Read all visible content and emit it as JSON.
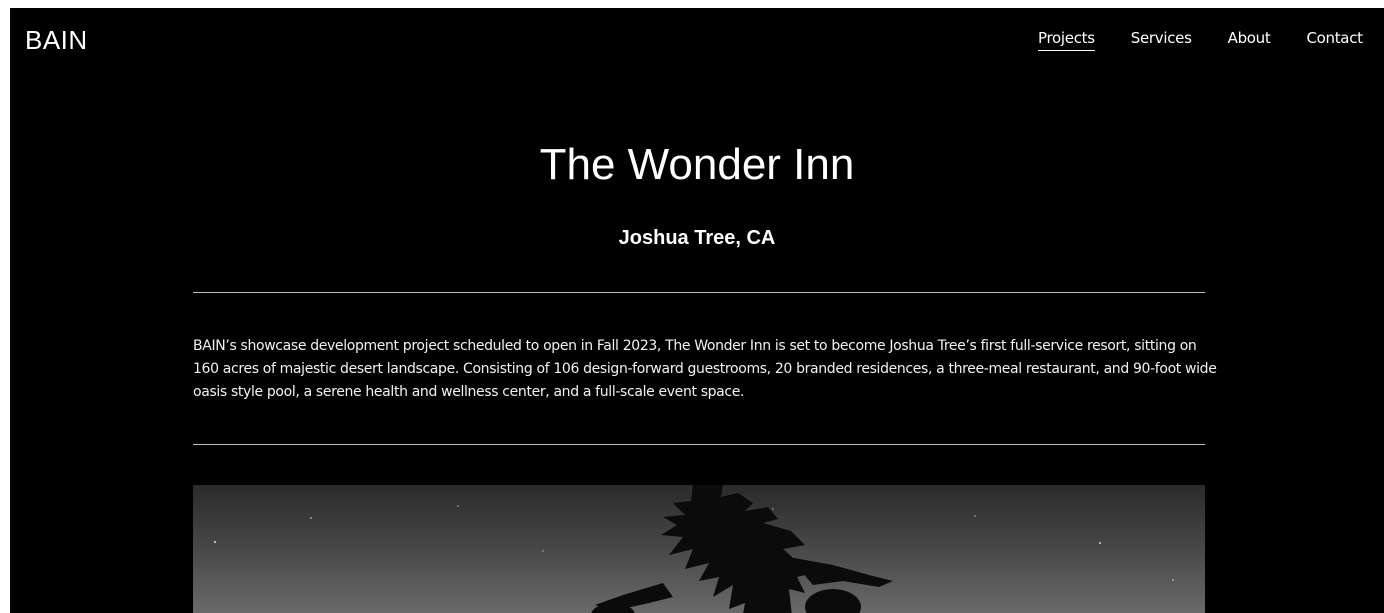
{
  "brand": {
    "logo": "BAIN"
  },
  "nav": {
    "items": [
      {
        "label": "Projects",
        "active": true
      },
      {
        "label": "Services",
        "active": false
      },
      {
        "label": "About",
        "active": false
      },
      {
        "label": "Contact",
        "active": false
      }
    ]
  },
  "project": {
    "title": "The Wonder Inn",
    "location": "Joshua Tree, CA",
    "description": "BAIN’s showcase development project scheduled to open in Fall 2023, The Wonder Inn is set to become Joshua Tree’s first full-service resort, sitting on 160 acres of majestic desert landscape. Consisting of 106 design-forward guestrooms, 20 branded residences, a three-meal restaurant,  and 90-foot wide oasis style pool, a serene health and wellness center, and a full-scale event space."
  },
  "colors": {
    "background": "#000000",
    "text": "#ffffff",
    "divider": "#bdbdbd"
  }
}
